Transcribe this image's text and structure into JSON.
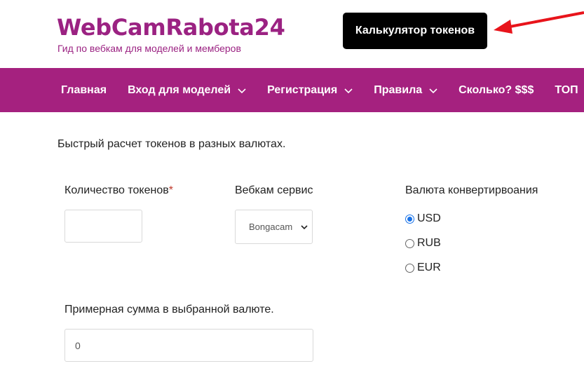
{
  "header": {
    "site_title": "WebCamRabota24",
    "tagline": "Гид по вебкам для моделей и мемберов",
    "calc_button": "Калькулятор токенов"
  },
  "nav": {
    "items": [
      {
        "label": "Главная",
        "dropdown": false
      },
      {
        "label": "Вход для моделей",
        "dropdown": true
      },
      {
        "label": "Регистрация",
        "dropdown": true
      },
      {
        "label": "Правила",
        "dropdown": true
      },
      {
        "label": "Сколько? $$$",
        "dropdown": false
      },
      {
        "label": "ТОП",
        "dropdown": false
      }
    ]
  },
  "form": {
    "intro": "Быстрый расчет токенов в разных валютах.",
    "tokens_label": "Количество токенов",
    "tokens_required": "*",
    "tokens_value": "",
    "service_label": "Вебкам сервис",
    "service_selected": "Bongacam",
    "currency_label": "Валюта конвертирвоания",
    "currency_options": [
      "USD",
      "RUB",
      "EUR"
    ],
    "currency_selected": "USD",
    "result_label": "Примерная сумма в выбранной валюте.",
    "result_value": "0"
  },
  "colors": {
    "brand": "#a5217f",
    "button_bg": "#000000",
    "arrow": "#e8141b"
  }
}
